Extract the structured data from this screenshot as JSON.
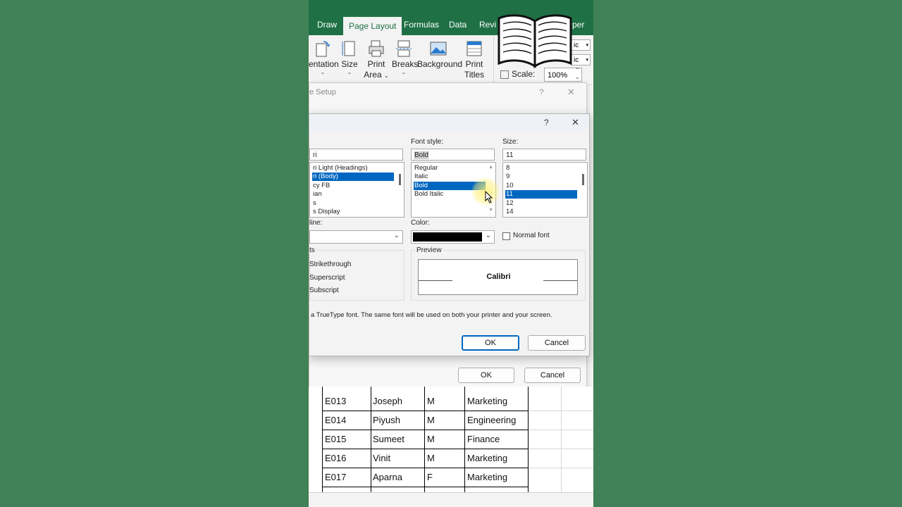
{
  "ribbon": {
    "tabs": [
      "Draw",
      "Page Layout",
      "Formulas",
      "Data",
      "Revi",
      "per"
    ],
    "buttons": [
      {
        "label": "entation"
      },
      {
        "label": "Size"
      },
      {
        "label": "Print",
        "sub": "Area"
      },
      {
        "label": "Breaks"
      },
      {
        "label": "Background"
      },
      {
        "label": "Print",
        "sub": "Titles"
      }
    ],
    "scale_label": "Scale:",
    "scale_value": "100%",
    "width_value": "ic",
    "height_value": "ic"
  },
  "page_setup": {
    "title": "e Setup",
    "help": "?",
    "close": "✕",
    "ok": "OK",
    "cancel": "Cancel"
  },
  "font_dialog": {
    "help": "?",
    "close": "✕",
    "font_value": "ri",
    "fonts": [
      "ri Light (Headings)",
      "ri (Body)",
      "cy FB",
      "ian",
      "s",
      "s Display"
    ],
    "font_style_label": "Font style:",
    "font_style_value": "Bold",
    "styles": [
      "Regular",
      "Italic",
      "Bold",
      "Bold Italic"
    ],
    "size_label": "Size:",
    "size_value": "11",
    "sizes": [
      "8",
      "9",
      "10",
      "11",
      "12",
      "14"
    ],
    "underline_label": "line:",
    "color_label": "Color:",
    "color_value": "#000000",
    "normal_font_label": "Normal font",
    "effects_label": "ts",
    "effects": [
      "Strikethrough",
      "Superscript",
      "Subscript"
    ],
    "preview_label": "Preview",
    "preview_text": "Calibri",
    "info_text": "a TrueType font.  The same font will be used on both your printer and your screen.",
    "ok": "OK",
    "cancel": "Cancel"
  },
  "sheet": {
    "rows": [
      [
        "E013",
        "Joseph",
        "M",
        "Marketing"
      ],
      [
        "E014",
        "Piyush",
        "M",
        "Engineering"
      ],
      [
        "E015",
        "Sumeet",
        "M",
        "Finance"
      ],
      [
        "E016",
        "Vinit",
        "M",
        "Marketing"
      ],
      [
        "E017",
        "Aparna",
        "F",
        "Marketing"
      ]
    ]
  },
  "colors": {
    "background": "#418157",
    "excel_green": "#1f7145",
    "selection": "#0067c0"
  }
}
